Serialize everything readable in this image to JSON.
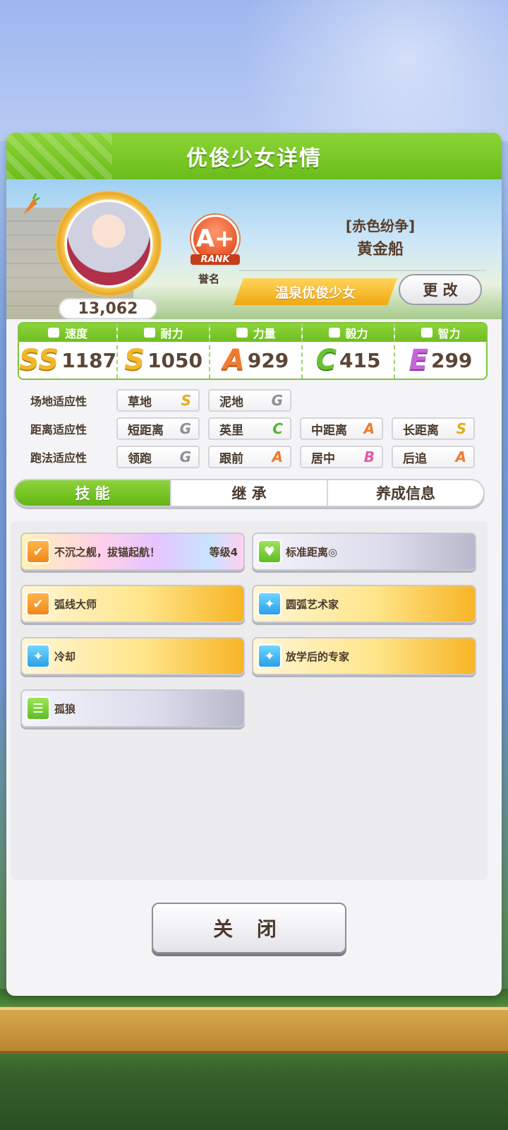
{
  "panel": {
    "title": "优俊少女详情"
  },
  "profile": {
    "score": "13,062",
    "rank": {
      "grade": "A+",
      "word": "RANK",
      "label": "誉名"
    },
    "epithet": "[赤色纷争]",
    "name": "黄金船",
    "tag": "温泉优俊少女",
    "change_label": "更 改"
  },
  "stats": [
    {
      "label": "速度",
      "grade": "SS",
      "value": "1187",
      "icon": "shoe-icon",
      "color": "#f0b82a"
    },
    {
      "label": "耐力",
      "grade": "S",
      "value": "1050",
      "icon": "heart-icon",
      "color": "#f0b82a"
    },
    {
      "label": "力量",
      "grade": "A",
      "value": "929",
      "icon": "arm-icon",
      "color": "#f07b2c"
    },
    {
      "label": "毅力",
      "grade": "C",
      "value": "415",
      "icon": "flame-icon",
      "color": "#69c235"
    },
    {
      "label": "智力",
      "grade": "E",
      "value": "299",
      "icon": "graduation-cap-icon",
      "color": "#c466d8"
    }
  ],
  "aptitude": {
    "field": {
      "label": "场地适应性",
      "items": [
        {
          "name": "草地",
          "grade": "S"
        },
        {
          "name": "泥地",
          "grade": "G"
        }
      ]
    },
    "distance": {
      "label": "距离适应性",
      "items": [
        {
          "name": "短距离",
          "grade": "G"
        },
        {
          "name": "英里",
          "grade": "C"
        },
        {
          "name": "中距离",
          "grade": "A"
        },
        {
          "name": "长距离",
          "grade": "S"
        }
      ]
    },
    "style": {
      "label": "跑法适应性",
      "items": [
        {
          "name": "领跑",
          "grade": "G"
        },
        {
          "name": "跟前",
          "grade": "A"
        },
        {
          "name": "居中",
          "grade": "B"
        },
        {
          "name": "后追",
          "grade": "A"
        }
      ]
    }
  },
  "tabs": [
    "技 能",
    "继 承",
    "养成信息"
  ],
  "skills": [
    {
      "name": "不沉之舰，拔锚起航！",
      "level": "等级4",
      "style": "rainbow",
      "icon": "running-figure-icon"
    },
    {
      "name": "标准距离◎",
      "style": "silver",
      "icon": "heart-icon"
    },
    {
      "name": "弧线大师",
      "style": "gold",
      "icon": "running-figure-icon"
    },
    {
      "name": "圆弧艺术家",
      "style": "gold",
      "icon": "sparkle-icon"
    },
    {
      "name": "冷却",
      "style": "gold",
      "icon": "sparkle-icon"
    },
    {
      "name": "放学后的专家",
      "style": "gold",
      "icon": "sparkle-icon"
    },
    {
      "name": "孤狼",
      "style": "silver",
      "icon": "document-icon"
    }
  ],
  "close_label": "关 闭"
}
